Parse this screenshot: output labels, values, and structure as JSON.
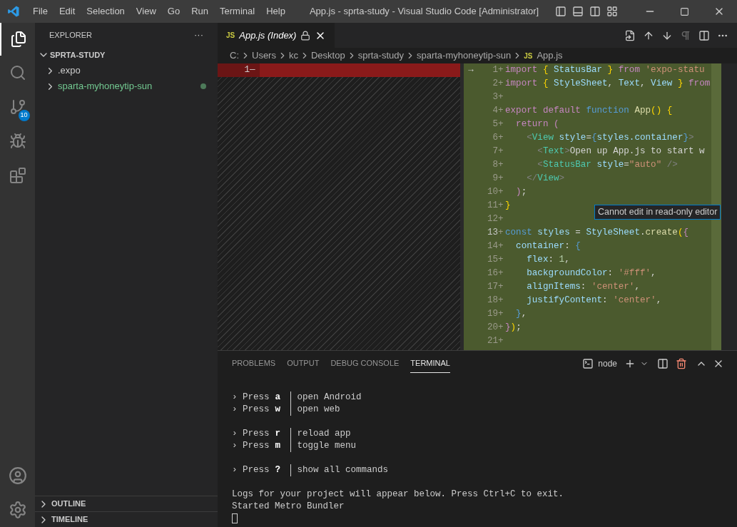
{
  "window": {
    "title": "App.js - sprta-study - Visual Studio Code [Administrator]"
  },
  "menu": [
    "File",
    "Edit",
    "Selection",
    "View",
    "Go",
    "Run",
    "Terminal",
    "Help"
  ],
  "activity_bar": {
    "source_control_badge": "10"
  },
  "sidebar": {
    "title": "EXPLORER",
    "more": "···",
    "root": "SPRTA-STUDY",
    "items": [
      {
        "label": ".expo",
        "modified": false
      },
      {
        "label": "sparta-myhoneytip-sun",
        "modified": true
      }
    ],
    "sections": [
      "OUTLINE",
      "TIMELINE"
    ]
  },
  "tab": {
    "label": "App.js (Index)",
    "file_badge": "JS"
  },
  "breadcrumbs": {
    "items": [
      "C:",
      "Users",
      "kc",
      "Desktop",
      "sprta-study",
      "sparta-myhoneytip-sun",
      "App.js"
    ],
    "file_badge": "JS"
  },
  "original_pane": {
    "lines": [
      {
        "number": "1",
        "marker": "—"
      }
    ]
  },
  "modified_pane": {
    "lines": [
      {
        "number": "1",
        "tokens": [
          {
            "text": "import ",
            "kind": "keyword"
          },
          {
            "text": "{ ",
            "kind": "brace"
          },
          {
            "text": "StatusBar ",
            "kind": "ident"
          },
          {
            "text": "} ",
            "kind": "brace"
          },
          {
            "text": "from ",
            "kind": "keyword"
          },
          {
            "text": "'expo-statu",
            "kind": "string"
          }
        ]
      },
      {
        "number": "2",
        "tokens": [
          {
            "text": "import ",
            "kind": "keyword"
          },
          {
            "text": "{ ",
            "kind": "brace"
          },
          {
            "text": "StyleSheet",
            "kind": "ident"
          },
          {
            "text": ", ",
            "kind": "plain"
          },
          {
            "text": "Text",
            "kind": "ident"
          },
          {
            "text": ", ",
            "kind": "plain"
          },
          {
            "text": "View ",
            "kind": "ident"
          },
          {
            "text": "} ",
            "kind": "brace"
          },
          {
            "text": "from",
            "kind": "keyword"
          }
        ]
      },
      {
        "number": "3"
      },
      {
        "number": "4",
        "tokens": [
          {
            "text": "export default ",
            "kind": "keyword"
          },
          {
            "text": "function ",
            "kind": "storage"
          },
          {
            "text": "App",
            "kind": "function"
          },
          {
            "text": "() {",
            "kind": "brace"
          }
        ]
      },
      {
        "number": "5",
        "tokens": [
          {
            "text": "  return ",
            "kind": "keyword"
          },
          {
            "text": "(",
            "kind": "keyword"
          }
        ]
      },
      {
        "number": "6",
        "tokens": [
          {
            "text": "    <",
            "kind": "angle"
          },
          {
            "text": "View ",
            "kind": "tag"
          },
          {
            "text": "style",
            "kind": "ident"
          },
          {
            "text": "=",
            "kind": "plain"
          },
          {
            "text": "{",
            "kind": "storage"
          },
          {
            "text": "styles.container",
            "kind": "ident"
          },
          {
            "text": "}",
            "kind": "storage"
          },
          {
            "text": ">",
            "kind": "angle"
          }
        ]
      },
      {
        "number": "7",
        "tokens": [
          {
            "text": "      <",
            "kind": "angle"
          },
          {
            "text": "Text",
            "kind": "tag"
          },
          {
            "text": ">",
            "kind": "angle"
          },
          {
            "text": "Open up App.js to start w",
            "kind": "plain"
          }
        ]
      },
      {
        "number": "8",
        "tokens": [
          {
            "text": "      <",
            "kind": "angle"
          },
          {
            "text": "StatusBar ",
            "kind": "tag"
          },
          {
            "text": "style",
            "kind": "ident"
          },
          {
            "text": "=",
            "kind": "plain"
          },
          {
            "text": "\"auto\"",
            "kind": "string"
          },
          {
            "text": " />",
            "kind": "angle"
          }
        ]
      },
      {
        "number": "9",
        "tokens": [
          {
            "text": "    </",
            "kind": "angle"
          },
          {
            "text": "View",
            "kind": "tag"
          },
          {
            "text": ">",
            "kind": "angle"
          }
        ]
      },
      {
        "number": "10",
        "tokens": [
          {
            "text": "  )",
            "kind": "keyword"
          },
          {
            "text": ";",
            "kind": "plain"
          }
        ]
      },
      {
        "number": "11",
        "tokens": [
          {
            "text": "}",
            "kind": "brace"
          }
        ]
      },
      {
        "number": "12"
      },
      {
        "number": "13",
        "tokens": [
          {
            "text": "const ",
            "kind": "storage"
          },
          {
            "text": "styles ",
            "kind": "ident"
          },
          {
            "text": "= ",
            "kind": "plain"
          },
          {
            "text": "StyleSheet",
            "kind": "ident"
          },
          {
            "text": ".",
            "kind": "plain"
          },
          {
            "text": "create",
            "kind": "function"
          },
          {
            "text": "(",
            "kind": "brace"
          },
          {
            "text": "{",
            "kind": "keyword"
          }
        ]
      },
      {
        "number": "14",
        "tokens": [
          {
            "text": "  container",
            "kind": "ident"
          },
          {
            "text": ": ",
            "kind": "plain"
          },
          {
            "text": "{",
            "kind": "storage"
          }
        ]
      },
      {
        "number": "15",
        "tokens": [
          {
            "text": "    flex",
            "kind": "ident"
          },
          {
            "text": ": ",
            "kind": "plain"
          },
          {
            "text": "1",
            "kind": "number"
          },
          {
            "text": ",",
            "kind": "plain"
          }
        ]
      },
      {
        "number": "16",
        "tokens": [
          {
            "text": "    backgroundColor",
            "kind": "ident"
          },
          {
            "text": ": ",
            "kind": "plain"
          },
          {
            "text": "'#fff'",
            "kind": "string"
          },
          {
            "text": ",",
            "kind": "plain"
          }
        ]
      },
      {
        "number": "17",
        "tokens": [
          {
            "text": "    alignItems",
            "kind": "ident"
          },
          {
            "text": ": ",
            "kind": "plain"
          },
          {
            "text": "'center'",
            "kind": "string"
          },
          {
            "text": ",",
            "kind": "plain"
          }
        ]
      },
      {
        "number": "18",
        "tokens": [
          {
            "text": "    justifyContent",
            "kind": "ident"
          },
          {
            "text": ": ",
            "kind": "plain"
          },
          {
            "text": "'center'",
            "kind": "string"
          },
          {
            "text": ",",
            "kind": "plain"
          }
        ]
      },
      {
        "number": "19",
        "tokens": [
          {
            "text": "  }",
            "kind": "storage"
          },
          {
            "text": ",",
            "kind": "plain"
          }
        ]
      },
      {
        "number": "20",
        "tokens": [
          {
            "text": "}",
            "kind": "keyword"
          },
          {
            "text": ")",
            "kind": "brace"
          },
          {
            "text": ";",
            "kind": "plain"
          }
        ]
      },
      {
        "number": "21"
      }
    ],
    "added_marker": "+",
    "arrow": "→"
  },
  "tooltip": "Cannot edit in read-only editor",
  "panel": {
    "tabs": [
      {
        "label": "PROBLEMS",
        "selected": false
      },
      {
        "label": "OUTPUT",
        "selected": false
      },
      {
        "label": "DEBUG CONSOLE",
        "selected": false
      },
      {
        "label": "TERMINAL",
        "selected": true
      }
    ],
    "shell": "node",
    "command_groups": [
      [
        {
          "prefix": "› Press",
          "key": "a",
          "action": "open Android"
        },
        {
          "prefix": "› Press",
          "key": "w",
          "action": "open web"
        }
      ],
      [
        {
          "prefix": "› Press",
          "key": "r",
          "action": "reload app"
        },
        {
          "prefix": "› Press",
          "key": "m",
          "action": "toggle menu"
        }
      ],
      [
        {
          "prefix": "› Press",
          "key": "?",
          "action": "show all commands"
        }
      ]
    ],
    "logs": [
      "Logs for your project will appear below. Press Ctrl+C to exit.",
      "Started Metro Bundler"
    ]
  }
}
